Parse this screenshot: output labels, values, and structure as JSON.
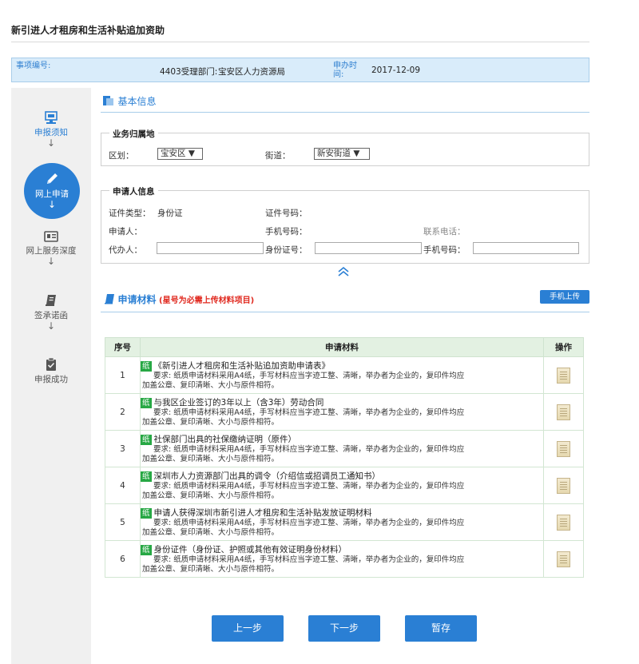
{
  "page_title": "新引进人才租房和生活补贴追加资助",
  "info": {
    "item_no_label": "事项编号:",
    "dept_label": "4403受理部门:",
    "dept_value": "宝安区人力资源局",
    "date_label": "申办时间:",
    "date_value": "2017-12-09"
  },
  "sidebar": {
    "steps": [
      {
        "label": "申报须知",
        "arrow": "↓"
      },
      {
        "label": "网上申请",
        "arrow": "↓"
      },
      {
        "label": "网上服务深度",
        "arrow": "↓"
      },
      {
        "label": "签承诺函",
        "arrow": "↓"
      },
      {
        "label": "申报成功"
      }
    ]
  },
  "basic": {
    "heading": "基本信息",
    "business": {
      "legend": "业务归属地",
      "district_label": "区划：",
      "district_value": "宝安区 ▼",
      "street_label": "街道：",
      "street_value": "新安街道 ▼"
    },
    "applicant": {
      "legend": "申请人信息",
      "cert_type_label": "证件类型：",
      "cert_type_value": "身份证",
      "cert_no_label": "证件号码：",
      "applicant_label": "申请人：",
      "phone_label": "手机号码：",
      "contact_label": "联系电话：",
      "agent_label": "代办人：",
      "id_label": "身份证号：",
      "agent_phone_label": "手机号码："
    },
    "collapse_icon": "double-chevron-up"
  },
  "materials": {
    "heading": "申请材料",
    "note": "(星号为必需上传材料项目)",
    "upload_button": "手机上传",
    "columns": [
      "序号",
      "申请材料",
      "操作"
    ],
    "tag": "纸",
    "rows": [
      {
        "no": "1",
        "title": "《新引进人才租房和生活补贴追加资助申请表》",
        "req1": "要求: 纸质申请材料采用A4纸，手写材料应当字迹工整、清晰，举办者为企业的，复印件均应",
        "req2": "加盖公章、复印清晰、大小与原件相符。"
      },
      {
        "no": "2",
        "title": "与我区企业签订的3年以上（含3年）劳动合同",
        "req1": "要求: 纸质申请材料采用A4纸，手写材料应当字迹工整、清晰，举办者为企业的，复印件均应",
        "req2": "加盖公章、复印清晰、大小与原件相符。"
      },
      {
        "no": "3",
        "title": "社保部门出具的社保缴纳证明（原件）",
        "req1": "要求: 纸质申请材料采用A4纸，手写材料应当字迹工整、清晰，举办者为企业的，复印件均应",
        "req2": "加盖公章、复印清晰、大小与原件相符。"
      },
      {
        "no": "4",
        "title": "深圳市人力资源部门出具的调令（介绍信或招调员工通知书）",
        "req1": "要求: 纸质申请材料采用A4纸，手写材料应当字迹工整、清晰，举办者为企业的，复印件均应",
        "req2": "加盖公章、复印清晰、大小与原件相符。"
      },
      {
        "no": "5",
        "title": "申请人获得深圳市新引进人才租房和生活补贴发放证明材料",
        "req1": "要求: 纸质申请材料采用A4纸，手写材料应当字迹工整、清晰，举办者为企业的，复印件均应",
        "req2": "加盖公章、复印清晰、大小与原件相符。"
      },
      {
        "no": "6",
        "title": "身份证件（身份证、护照或其他有效证明身份材料）",
        "req1": "要求: 纸质申请材料采用A4纸，手写材料应当字迹工整、清晰，举办者为企业的，复印件均应",
        "req2": "加盖公章、复印清晰、大小与原件相符。"
      }
    ]
  },
  "buttons": {
    "prev": "上一步",
    "next": "下一步",
    "save": "暂存"
  },
  "colors": {
    "primary": "#2a7fd4",
    "header_bg": "#d9ecfa",
    "table_header": "#e3f1e2",
    "tag_green": "#27a844",
    "note_red": "#e0281e"
  }
}
